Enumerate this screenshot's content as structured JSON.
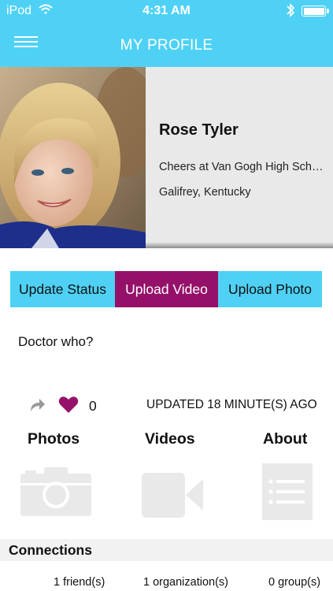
{
  "status_bar": {
    "carrier": "iPod",
    "time": "4:31 AM",
    "wifi_icon": "wifi-icon",
    "bluetooth_icon": "bluetooth-icon",
    "battery_icon": "battery-icon",
    "battery_level": 1.0
  },
  "nav": {
    "title": "MY PROFILE",
    "menu_icon": "hamburger-menu-icon"
  },
  "profile": {
    "name": "Rose Tyler",
    "headline": "Cheers at Van Gogh High School",
    "location": "Galifrey, Kentucky"
  },
  "actions": {
    "update_status": "Update Status",
    "upload_video": "Upload Video",
    "upload_photo": "Upload Photo"
  },
  "status_text": "Doctor who?",
  "stats": {
    "share_icon": "share-icon",
    "heart_icon": "heart-icon",
    "likes": "0",
    "updated": "UPDATED 18 MINUTE(S) AGO"
  },
  "tabs": {
    "photos": "Photos",
    "videos": "Videos",
    "about": "About"
  },
  "connections": {
    "title": "Connections",
    "friends": "1 friend(s)",
    "organizations": "1 organization(s)",
    "groups": "0 group(s)"
  },
  "colors": {
    "accent": "#4fd1f5",
    "highlight": "#951169",
    "icon_gray": "#e9e9e9"
  }
}
